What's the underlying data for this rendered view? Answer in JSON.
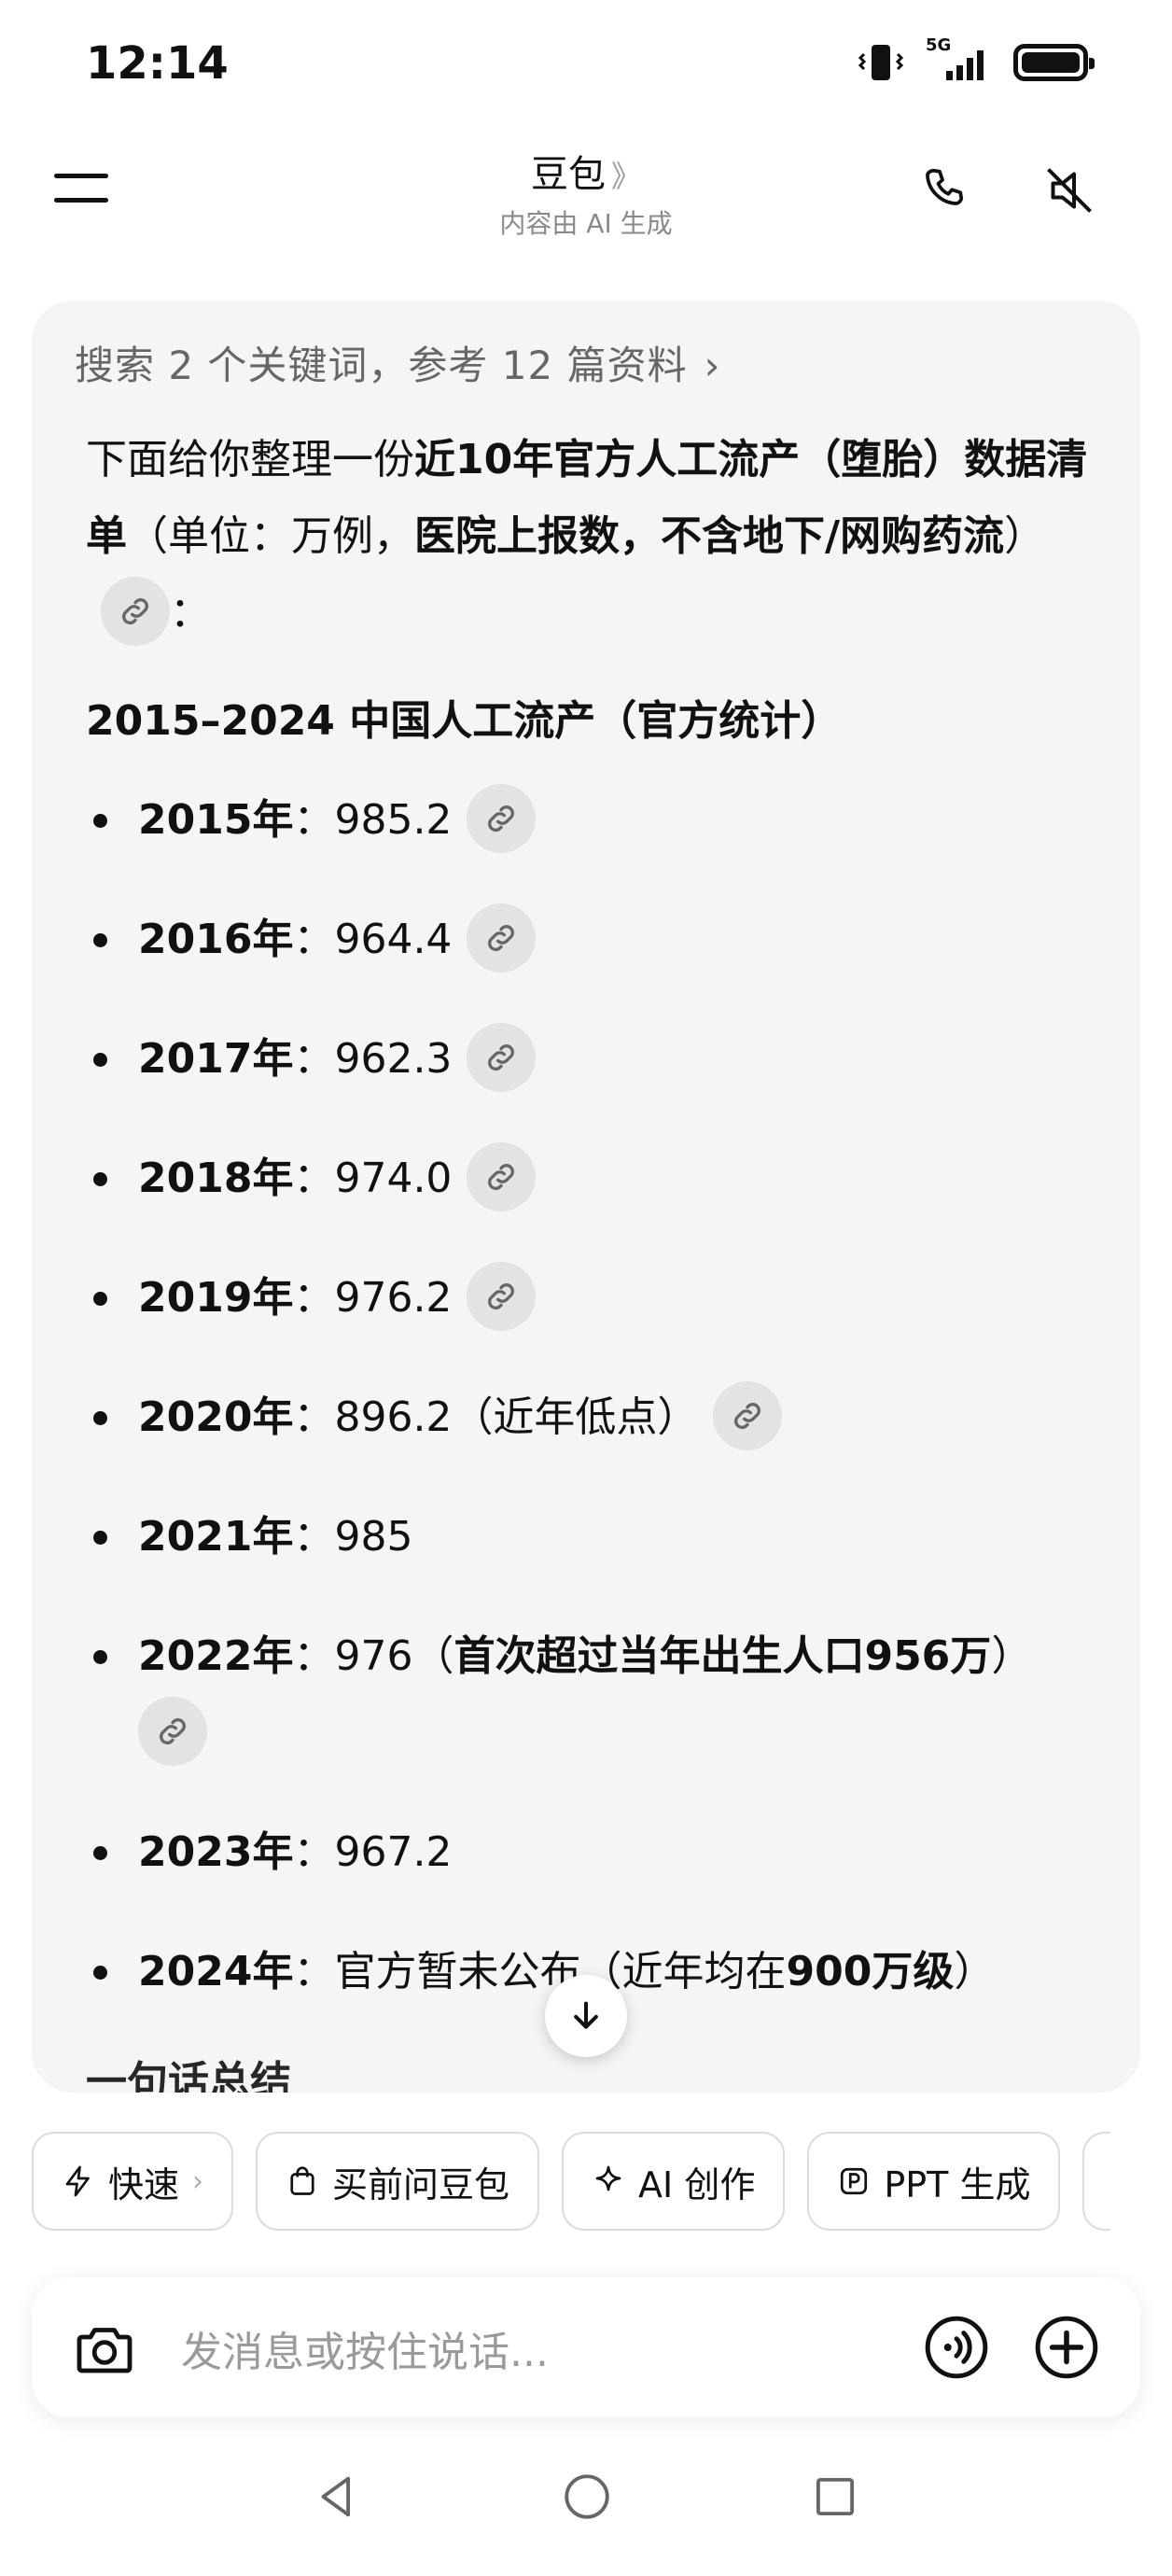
{
  "status_bar": {
    "time": "12:14",
    "network": "5G"
  },
  "header": {
    "title": "豆包",
    "title_chevron": "》",
    "subtitle": "内容由 AI 生成"
  },
  "search_summary": {
    "text": "搜索 2 个关键词，参考 12 篇资料",
    "chevron": "›"
  },
  "intro": {
    "part1": "下面给你整理一份",
    "bold1": "近10年官方人工流产（堕胎）数据清单",
    "part2": "（单位：万例，",
    "bold2": "医院上报数，不含地下/网购药流",
    "part3": "）",
    "part4": "："
  },
  "heading": "2015–2024 中国人工流产（官方统计）",
  "years": [
    {
      "year": "2015年",
      "value": "：985.2"
    },
    {
      "year": "2016年",
      "value": "：964.4"
    },
    {
      "year": "2017年",
      "value": "：962.3"
    },
    {
      "year": "2018年",
      "value": "：974.0"
    },
    {
      "year": "2019年",
      "value": "：976.2"
    },
    {
      "year": "2020年",
      "value": "：896.2",
      "note": "（近年低点）"
    },
    {
      "year": "2021年",
      "value": "：985"
    },
    {
      "year": "2022年",
      "value": "：976",
      "note_open": "（",
      "note_bold": "首次超过当年出生人口956万",
      "note_close": "）"
    },
    {
      "year": "2023年",
      "value": "：967.2"
    },
    {
      "year": "2024年",
      "value": "：官方暂未公",
      "hidden_tail": "布",
      "note_open": "（近年均在",
      "note_bold": "900万级",
      "note_close": "）"
    }
  ],
  "truncated_next": "一句话总结",
  "chips": [
    {
      "label": "快速",
      "chevron": "›",
      "icon": "lightning-icon"
    },
    {
      "label": "买前问豆包",
      "icon": "shopping-bag-icon"
    },
    {
      "label": "AI 创作",
      "icon": "sparkle-icon"
    },
    {
      "label": "PPT 生成",
      "icon": "ppt-icon"
    }
  ],
  "input": {
    "placeholder": "发消息或按住说话..."
  }
}
